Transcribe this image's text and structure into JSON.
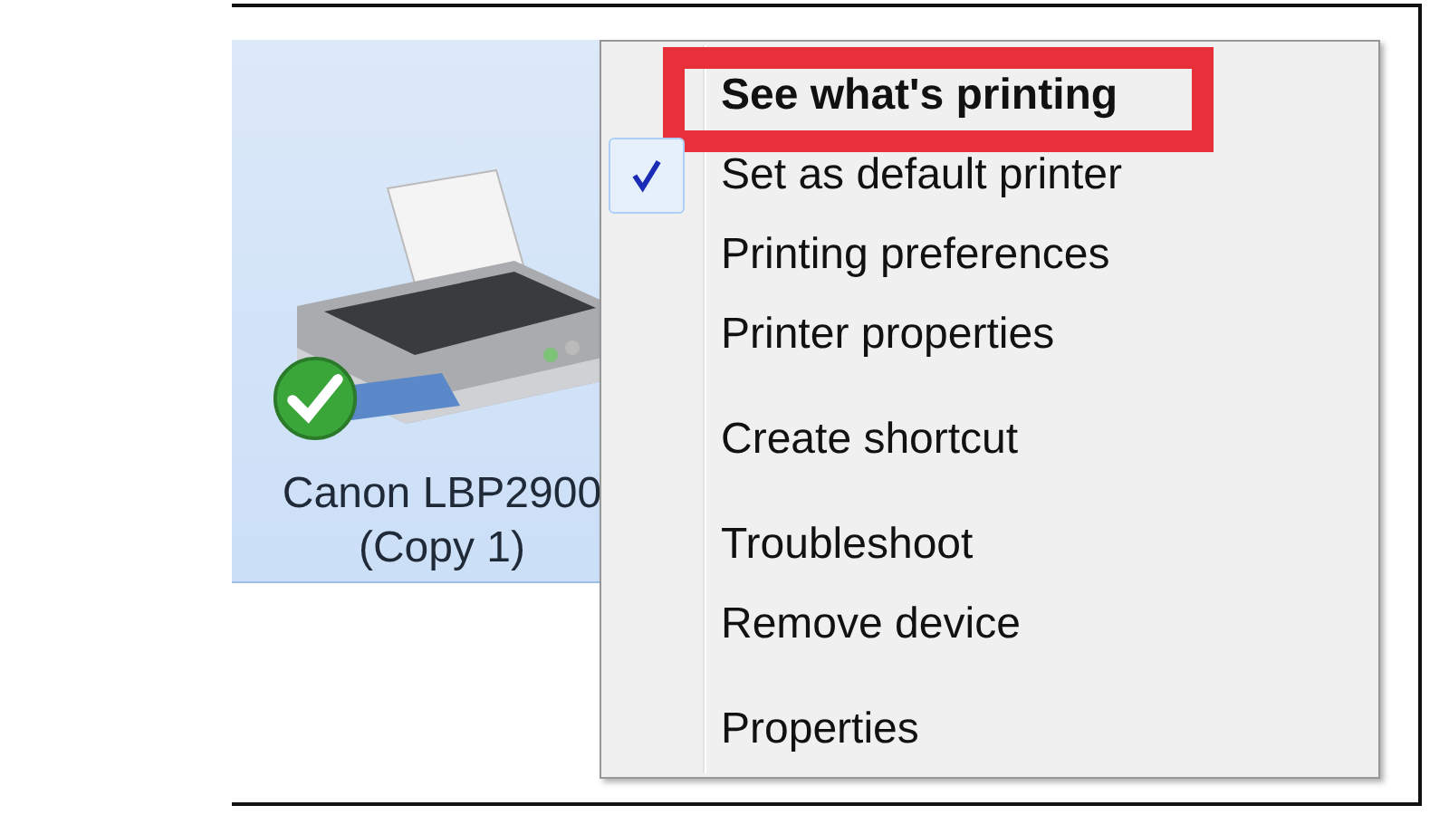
{
  "device": {
    "name": "Canon LBP2900",
    "name_line2": "(Copy 1)",
    "selected": true,
    "default": true
  },
  "menu": {
    "items": [
      {
        "kind": "item",
        "label": "See what's printing",
        "bold": true,
        "checked": false,
        "highlighted": true
      },
      {
        "kind": "item",
        "label": "Set as default printer",
        "bold": false,
        "checked": true,
        "highlighted": false
      },
      {
        "kind": "item",
        "label": "Printing preferences",
        "bold": false,
        "checked": false,
        "highlighted": false
      },
      {
        "kind": "item",
        "label": "Printer properties",
        "bold": false,
        "checked": false,
        "highlighted": false
      },
      {
        "kind": "separator"
      },
      {
        "kind": "item",
        "label": "Create shortcut",
        "bold": false,
        "checked": false,
        "highlighted": false
      },
      {
        "kind": "separator"
      },
      {
        "kind": "item",
        "label": "Troubleshoot",
        "bold": false,
        "checked": false,
        "highlighted": false
      },
      {
        "kind": "item",
        "label": "Remove device",
        "bold": false,
        "checked": false,
        "highlighted": false
      },
      {
        "kind": "separator"
      },
      {
        "kind": "item",
        "label": "Properties",
        "bold": false,
        "checked": false,
        "highlighted": false
      }
    ]
  }
}
